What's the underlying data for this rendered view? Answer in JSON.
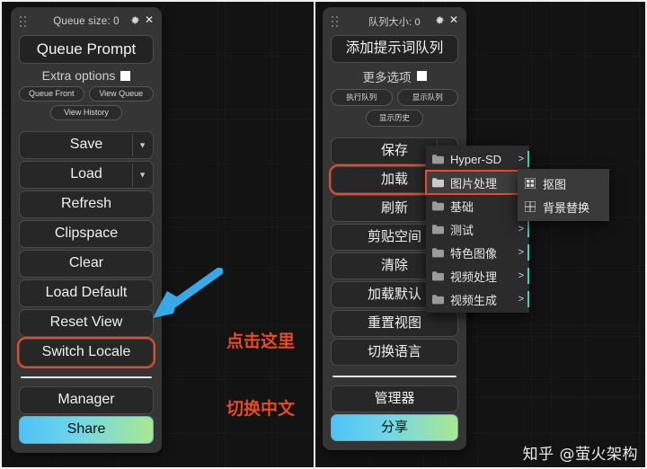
{
  "left_panel": {
    "queue_size_label": "Queue size: 0",
    "gear_icon": "gear-icon",
    "close_icon": "close-icon",
    "queue_prompt_label": "Queue Prompt",
    "extra_options_label": "Extra options",
    "pills": [
      "Queue Front",
      "View Queue",
      "View History"
    ],
    "buttons": [
      {
        "label": "Save",
        "caret": "▼"
      },
      {
        "label": "Load",
        "caret": "▼"
      },
      {
        "label": "Refresh",
        "caret": ""
      },
      {
        "label": "Clipspace",
        "caret": ""
      },
      {
        "label": "Clear",
        "caret": ""
      },
      {
        "label": "Load Default",
        "caret": ""
      },
      {
        "label": "Reset View",
        "caret": ""
      },
      {
        "label": "Switch Locale",
        "caret": ""
      }
    ],
    "manager_label": "Manager",
    "share_label": "Share"
  },
  "right_panel": {
    "queue_size_label": "队列大小: 0",
    "gear_icon": "gear-icon",
    "close_icon": "close-icon",
    "queue_prompt_label": "添加提示词队列",
    "extra_options_label": "更多选项",
    "pills": [
      "执行队列",
      "显示队列",
      "显示历史"
    ],
    "buttons": [
      {
        "label": "保存",
        "caret": "▼"
      },
      {
        "label": "加载",
        "caret": "▼"
      },
      {
        "label": "刷新",
        "caret": ""
      },
      {
        "label": "剪贴空间",
        "caret": ""
      },
      {
        "label": "清除",
        "caret": ""
      },
      {
        "label": "加载默认",
        "caret": ""
      },
      {
        "label": "重置视图",
        "caret": ""
      },
      {
        "label": "切换语言",
        "caret": ""
      }
    ],
    "manager_label": "管理器",
    "share_label": "分享"
  },
  "dropdown": {
    "items": [
      {
        "label": "Hyper-SD",
        "icon": "folder-icon",
        "arrow": ">"
      },
      {
        "label": "图片处理",
        "icon": "folder-icon",
        "arrow": ">"
      },
      {
        "label": "基础",
        "icon": "folder-icon",
        "arrow": ">"
      },
      {
        "label": "测试",
        "icon": "folder-icon",
        "arrow": ">"
      },
      {
        "label": "特色图像",
        "icon": "folder-icon",
        "arrow": ">"
      },
      {
        "label": "视频处理",
        "icon": "folder-icon",
        "arrow": ">"
      },
      {
        "label": "视频生成",
        "icon": "folder-icon",
        "arrow": ">"
      }
    ],
    "submenu": [
      {
        "label": "抠图",
        "icon": "grid-icon"
      },
      {
        "label": "背景替换",
        "icon": "grid-icon"
      }
    ]
  },
  "annotation": {
    "line1": "点击这里",
    "line2": "切换中文",
    "arrow_icon": "arrow-pointer-icon",
    "color": "#e8492a",
    "arrow_color": "#38a8e8"
  },
  "watermark": {
    "text": "知乎 @萤火架构"
  },
  "colors": {
    "panel_bg": "#353535",
    "button_bg": "#272727",
    "highlight_outline": "#e8492a",
    "share_gradient_start": "#4ec3f7",
    "share_gradient_end": "#a9e88f",
    "teal_bar": "#31d6c6"
  }
}
